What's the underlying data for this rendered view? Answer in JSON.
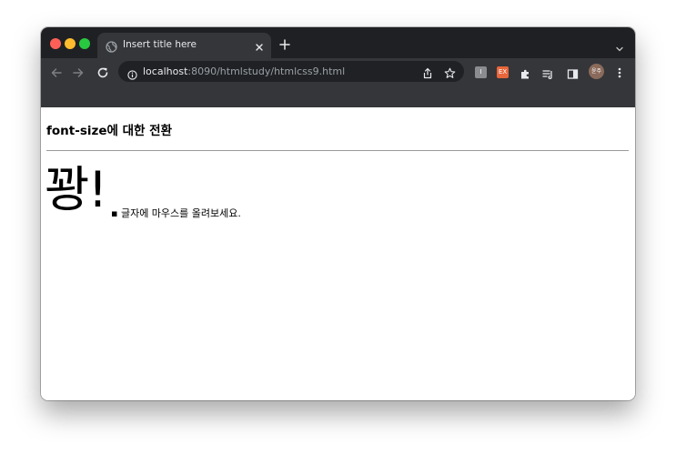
{
  "browser": {
    "tab": {
      "title": "Insert title here"
    },
    "address_bar": {
      "host": "localhost",
      "path": ":8090/htmlstudy/htmlcss9.html"
    },
    "extensions": {
      "ext1_label": "I",
      "ext2_label": "EX"
    },
    "profile": {
      "initials": "윤주"
    },
    "colors": {
      "tabbar": "#1f2023",
      "toolbar": "#35363a",
      "omnibox": "#202124"
    }
  },
  "page": {
    "heading": "font-size에 대한 전환",
    "big_text": "꽝!",
    "hint": "글자에 마우스를 올려보세요."
  }
}
